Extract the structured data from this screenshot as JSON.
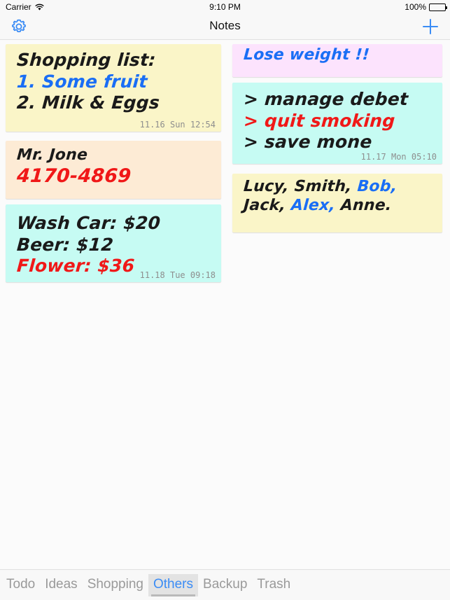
{
  "status_bar": {
    "carrier": "Carrier",
    "wifi_icon": "wifi-icon",
    "time": "9:10 PM",
    "battery_percent": "100%",
    "battery_icon": "battery-icon"
  },
  "nav_bar": {
    "title": "Notes",
    "settings_icon": "gear-icon",
    "add_icon": "plus-icon"
  },
  "colors": {
    "accent_blue": "#1a6ef5",
    "ink_black": "#1a1a1a",
    "ink_red": "#f01818",
    "note_yellow": "#faf5c8",
    "note_peach": "#fdebd5",
    "note_mint": "#c6fbf3",
    "note_pink": "#fce3fd",
    "tab_selected": "#3b8cf5",
    "tab_normal": "#9a9a9a"
  },
  "notes": [
    {
      "id": "note-shopping-list",
      "color": "#faf5c8",
      "column": "left",
      "lines": [
        {
          "text": "Shopping list:",
          "color": "#1a1a1a"
        },
        {
          "text": "1. Some fruit",
          "color": "#1a6ef5"
        },
        {
          "text": "2. Milk & Eggs",
          "color": "#1a1a1a"
        }
      ],
      "timestamp": "11.16 Sun 12:54"
    },
    {
      "id": "note-mr-jone",
      "color": "#fdebd5",
      "column": "left",
      "lines": [
        {
          "text": "Mr. Jone",
          "color": "#1a1a1a"
        },
        {
          "text": "4170-4869",
          "color": "#f01818"
        }
      ],
      "timestamp": ""
    },
    {
      "id": "note-expenses",
      "color": "#c6fbf3",
      "column": "left",
      "lines": [
        {
          "text": "Wash Car: $20",
          "color": "#1a1a1a"
        },
        {
          "text": "Beer: $12",
          "color": "#1a1a1a"
        },
        {
          "text": "Flower: $36",
          "color": "#f01818"
        }
      ],
      "timestamp": "11.18 Tue 09:18"
    },
    {
      "id": "note-lose-weight",
      "color": "#fce3fd",
      "column": "right",
      "lines": [
        {
          "text": "Lose weight !!",
          "color": "#1a6ef5"
        }
      ],
      "timestamp": ""
    },
    {
      "id": "note-goals",
      "color": "#c6fbf3",
      "column": "right",
      "lines": [
        {
          "text": "> manage debet",
          "color": "#1a1a1a"
        },
        {
          "text": "> quit smoking",
          "color": "#f01818"
        },
        {
          "text": "> save mone",
          "color": "#1a1a1a"
        }
      ],
      "timestamp": "11.17 Mon 05:10"
    },
    {
      "id": "note-names",
      "color": "#faf5c8",
      "column": "right",
      "lines": [
        {
          "text": "Lucy, Smith, Bob,",
          "color": "#1a1a1a"
        },
        {
          "text": "Jack, Alex, Anne.",
          "color": "#1a1a1a"
        }
      ],
      "timestamp": ""
    }
  ],
  "tab_bar": {
    "tabs": [
      {
        "label": "Todo",
        "selected": false
      },
      {
        "label": "Ideas",
        "selected": false
      },
      {
        "label": "Shopping",
        "selected": false
      },
      {
        "label": "Others",
        "selected": true
      },
      {
        "label": "Backup",
        "selected": false
      },
      {
        "label": "Trash",
        "selected": false
      }
    ]
  }
}
